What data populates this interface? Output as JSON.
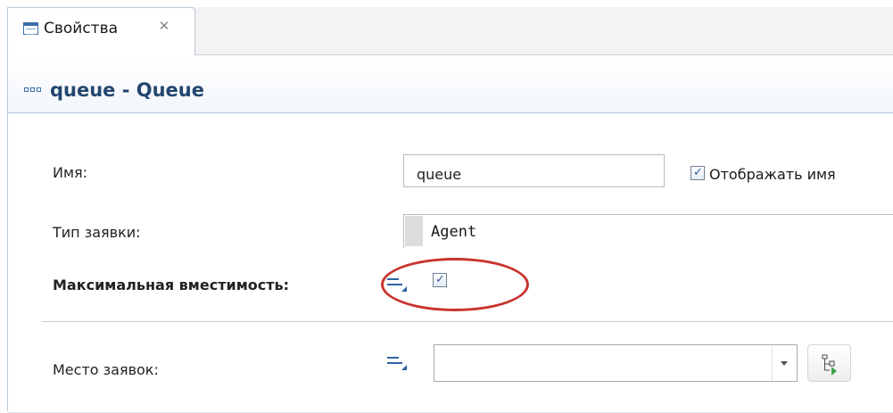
{
  "tab": {
    "label": "Свойства",
    "icon": "properties-table-icon",
    "close_icon": "close-icon"
  },
  "header": {
    "title": "queue - Queue",
    "icon": "queue-block-icon"
  },
  "fields": {
    "name": {
      "label": "Имя:",
      "value": "queue",
      "show_name_label": "Отображать имя",
      "show_name_checked": true
    },
    "agent_type": {
      "label": "Тип заявки:",
      "value": "Agent"
    },
    "max_capacity": {
      "label": "Максимальная вместимость:",
      "checked": true,
      "icon": "static-value-icon"
    },
    "agent_location": {
      "label": "Место заявок:",
      "value": "",
      "icon": "static-value-icon",
      "picker_icon": "select-location-icon"
    }
  },
  "colors": {
    "title": "#23466e",
    "accent": "#2e62a4",
    "highlight_ellipse": "#c8342e"
  }
}
